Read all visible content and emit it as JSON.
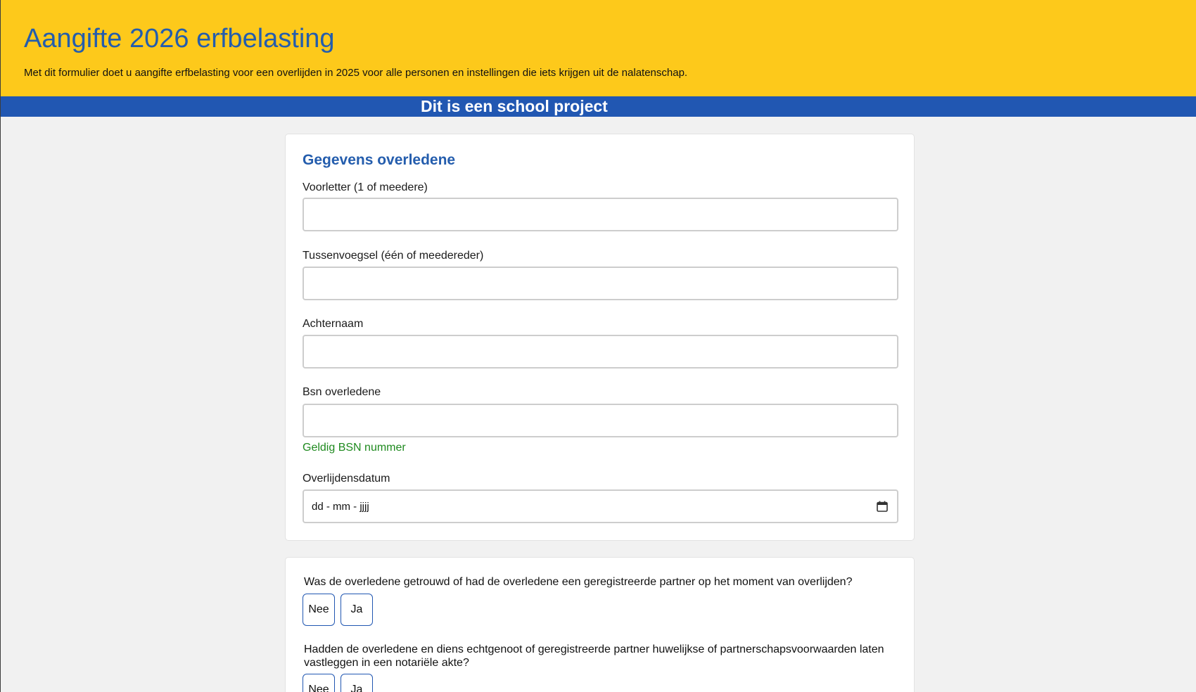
{
  "header": {
    "title": "Aangifte 2026 erfbelasting",
    "subtitle": "Met dit formulier doet u aangifte erfbelasting voor een overlijden in 2025 voor alle personen en instellingen die iets krijgen uit de nalatenschap."
  },
  "banner": {
    "text": "Dit is een school project"
  },
  "deceased_section": {
    "title": "Gegevens overledene",
    "fields": [
      {
        "label": "Voorletter (1 of meedere)",
        "value": ""
      },
      {
        "label": "Tussenvoegsel (één of meedereder)",
        "value": ""
      },
      {
        "label": "Achternaam",
        "value": ""
      },
      {
        "label": "Bsn overledene",
        "value": "",
        "hint": "Geldig BSN nummer"
      }
    ],
    "date_field": {
      "label": "Overlijdensdatum",
      "placeholder": "dd - mm - jjjj",
      "icon": "calendar-icon"
    }
  },
  "questions_section": {
    "questions": [
      {
        "text": "Was de overledene getrouwd of had de overledene een geregistreerde partner op het moment van overlijden?",
        "options": [
          "Nee",
          "Ja"
        ]
      },
      {
        "text": "Hadden de overledene en diens echtgenoot of geregistreerde partner huwelijkse of partnerschapsvoorwaarden laten vastleggen in een notariële akte?",
        "options": [
          "Nee",
          "Ja"
        ]
      }
    ]
  },
  "colors": {
    "header_bg": "#fdc91b",
    "accent_blue": "#245dad",
    "banner_bg": "#2157b2",
    "valid_green": "#1f8a1f"
  }
}
